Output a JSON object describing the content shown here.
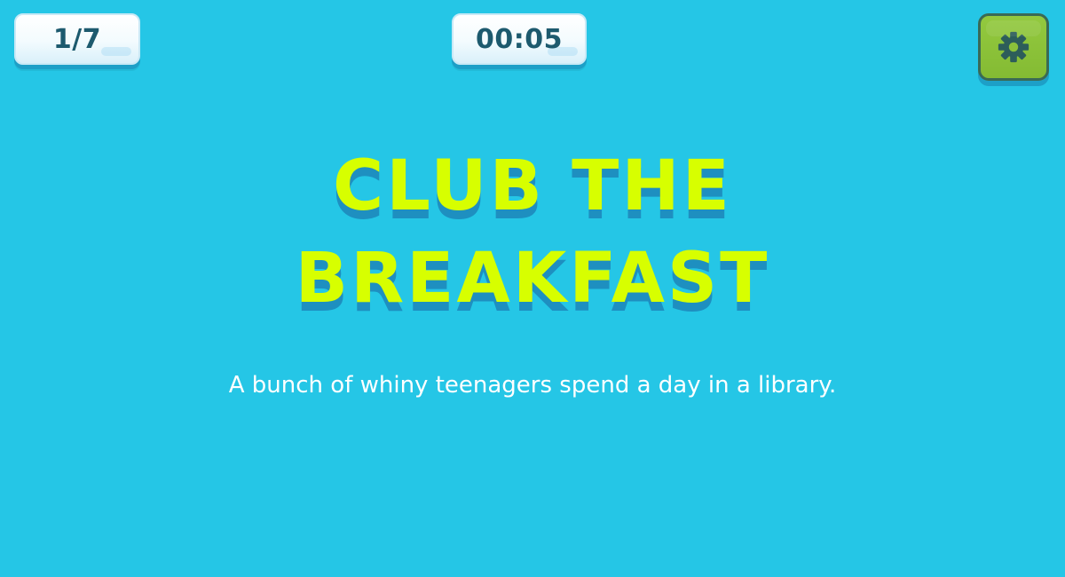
{
  "hud": {
    "progress": "1/7",
    "timer": "00:05"
  },
  "settings": {
    "icon": "gear-icon"
  },
  "puzzle": {
    "title": "CLUB THE BREAKFAST",
    "description": "A bunch of whiny teenagers spend a day in a library."
  },
  "colors": {
    "background": "#25c6e6",
    "title": "#d7ff00",
    "title_shadow": "#1e8fc0",
    "hud_text": "#1d5a6e",
    "settings_button": "#8bc13a"
  }
}
